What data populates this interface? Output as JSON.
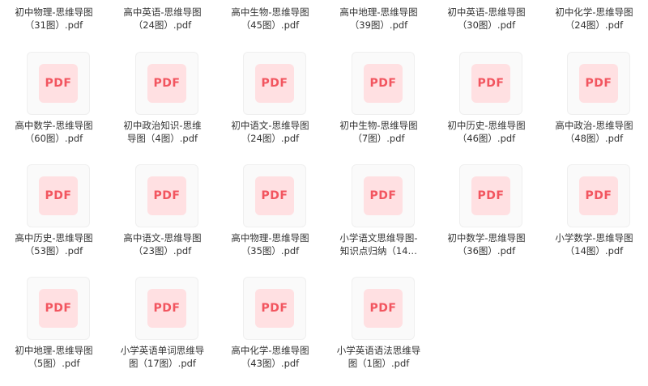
{
  "colors": {
    "badge_bg": "#ffe0e2",
    "badge_text": "#f2555f",
    "thumb_bg": "#fafafa",
    "text": "#333333"
  },
  "badge_label": "PDF",
  "badge_icon": "pdf-file-icon",
  "top_row": [
    {
      "name": "初中物理-思维导图\n（31图）.pdf"
    },
    {
      "name": "高中英语-思维导图\n（24图）.pdf"
    },
    {
      "name": "高中生物-思维导图\n（45图）.pdf"
    },
    {
      "name": "高中地理-思维导图\n（39图）.pdf"
    },
    {
      "name": "初中英语-思维导图\n（30图）.pdf"
    },
    {
      "name": "初中化学-思维导图\n（24图）.pdf"
    }
  ],
  "files": [
    {
      "name": "高中数学-思维导图\n（60图）.pdf"
    },
    {
      "name": "初中政治知识-思维\n导图（4图）.pdf"
    },
    {
      "name": "初中语文-思维导图\n（24图）.pdf"
    },
    {
      "name": "初中生物-思维导图\n（7图）.pdf"
    },
    {
      "name": "初中历史-思维导图\n（46图）.pdf"
    },
    {
      "name": "高中政治-思维导图\n（48图）.pdf"
    },
    {
      "name": "高中历史-思维导图\n（53图）.pdf"
    },
    {
      "name": "高中语文-思维导图\n（23图）.pdf"
    },
    {
      "name": "高中物理-思维导图\n（35图）.pdf"
    },
    {
      "name": "小学语文思维导图-\n知识点归纳（14…"
    },
    {
      "name": "初中数学-思维导图\n（36图）.pdf"
    },
    {
      "name": "小学数学-思维导图\n（14图）.pdf"
    },
    {
      "name": "初中地理-思维导图\n（5图）.pdf"
    },
    {
      "name": "小学英语单词思维导\n图（17图）.pdf"
    },
    {
      "name": "高中化学-思维导图\n（43图）.pdf"
    },
    {
      "name": "小学英语语法思维导\n图（1图）.pdf"
    }
  ]
}
